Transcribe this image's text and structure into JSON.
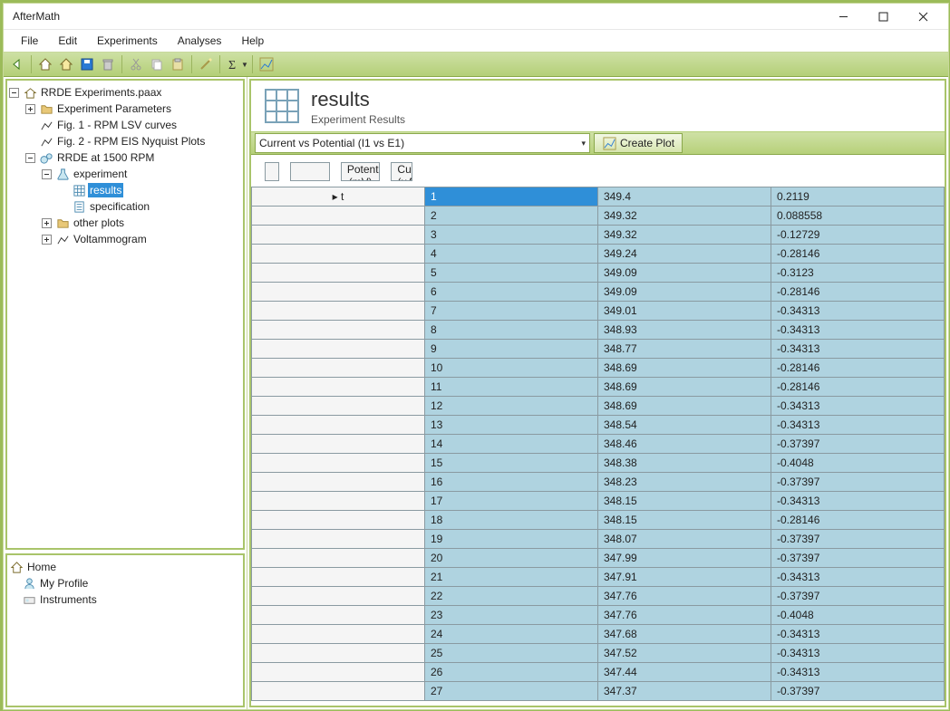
{
  "window": {
    "title": "AfterMath"
  },
  "menu": {
    "file": "File",
    "edit": "Edit",
    "experiments": "Experiments",
    "analyses": "Analyses",
    "help": "Help"
  },
  "tree": {
    "root": "RRDE Experiments.paax",
    "n1": "Experiment Parameters",
    "n2": "Fig. 1 - RPM LSV curves",
    "n3": "Fig. 2 - RPM EIS Nyquist Plots",
    "n4": "RRDE at 1500 RPM",
    "n5": "experiment",
    "n6": "results",
    "n7": "specification",
    "n8": "other plots",
    "n9": "Voltammogram"
  },
  "nav": {
    "home": "Home",
    "profile": "My Profile",
    "instruments": "Instruments"
  },
  "header": {
    "title": "results",
    "subtitle": "Experiment Results"
  },
  "selector": {
    "label": "Current vs Potential (I1 vs E1)",
    "create": "Create Plot"
  },
  "columns": {
    "sel": "t",
    "pot": "Potential (mV)",
    "cur": "Current (µA)"
  },
  "rows": [
    {
      "i": "1",
      "p": "349.4",
      "c": "0.2119"
    },
    {
      "i": "2",
      "p": "349.32",
      "c": "0.088558"
    },
    {
      "i": "3",
      "p": "349.32",
      "c": "-0.12729"
    },
    {
      "i": "4",
      "p": "349.24",
      "c": "-0.28146"
    },
    {
      "i": "5",
      "p": "349.09",
      "c": "-0.3123"
    },
    {
      "i": "6",
      "p": "349.09",
      "c": "-0.28146"
    },
    {
      "i": "7",
      "p": "349.01",
      "c": "-0.34313"
    },
    {
      "i": "8",
      "p": "348.93",
      "c": "-0.34313"
    },
    {
      "i": "9",
      "p": "348.77",
      "c": "-0.34313"
    },
    {
      "i": "10",
      "p": "348.69",
      "c": "-0.28146"
    },
    {
      "i": "11",
      "p": "348.69",
      "c": "-0.28146"
    },
    {
      "i": "12",
      "p": "348.69",
      "c": "-0.34313"
    },
    {
      "i": "13",
      "p": "348.54",
      "c": "-0.34313"
    },
    {
      "i": "14",
      "p": "348.46",
      "c": "-0.37397"
    },
    {
      "i": "15",
      "p": "348.38",
      "c": "-0.4048"
    },
    {
      "i": "16",
      "p": "348.23",
      "c": "-0.37397"
    },
    {
      "i": "17",
      "p": "348.15",
      "c": "-0.34313"
    },
    {
      "i": "18",
      "p": "348.15",
      "c": "-0.28146"
    },
    {
      "i": "19",
      "p": "348.07",
      "c": "-0.37397"
    },
    {
      "i": "20",
      "p": "347.99",
      "c": "-0.37397"
    },
    {
      "i": "21",
      "p": "347.91",
      "c": "-0.34313"
    },
    {
      "i": "22",
      "p": "347.76",
      "c": "-0.37397"
    },
    {
      "i": "23",
      "p": "347.76",
      "c": "-0.4048"
    },
    {
      "i": "24",
      "p": "347.68",
      "c": "-0.34313"
    },
    {
      "i": "25",
      "p": "347.52",
      "c": "-0.34313"
    },
    {
      "i": "26",
      "p": "347.44",
      "c": "-0.34313"
    },
    {
      "i": "27",
      "p": "347.37",
      "c": "-0.37397"
    }
  ]
}
